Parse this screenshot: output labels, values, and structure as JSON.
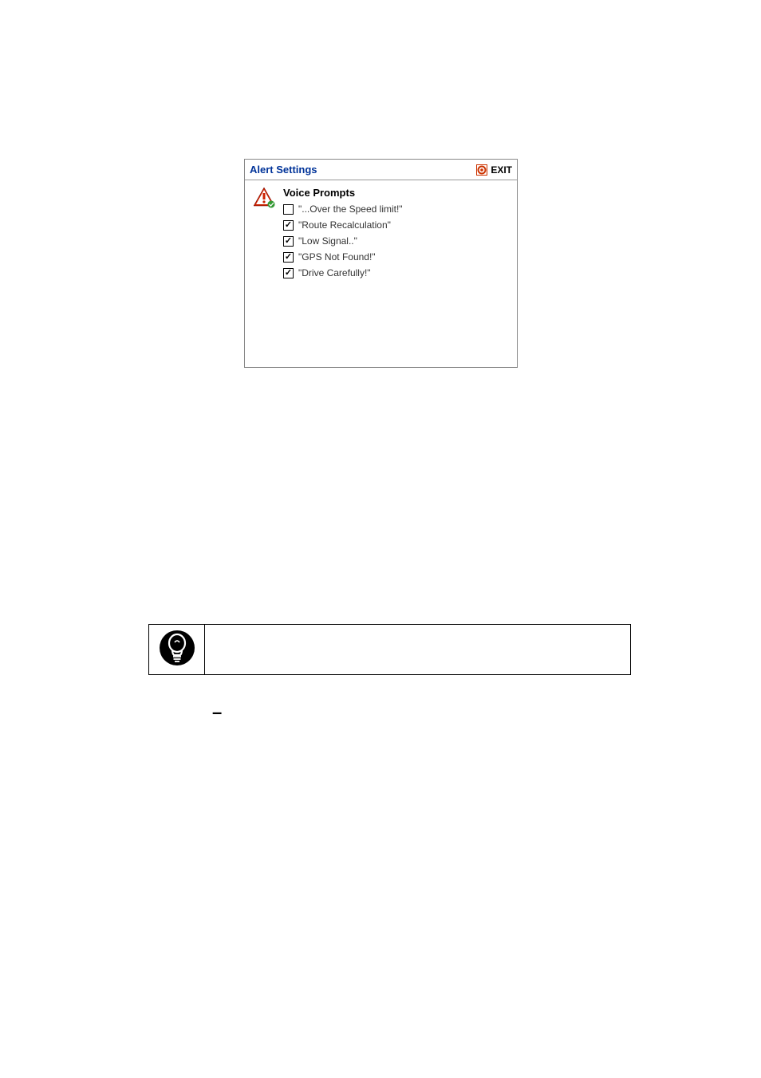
{
  "panel": {
    "title": "Alert Settings",
    "exit_label": "EXIT"
  },
  "voice_prompts": {
    "heading": "Voice Prompts",
    "items": [
      {
        "label": "\"...Over the Speed limit!\"",
        "checked": false
      },
      {
        "label": "\"Route Recalculation\"",
        "checked": true
      },
      {
        "label": "\"Low Signal..\"",
        "checked": true
      },
      {
        "label": "\"GPS Not Found!\"",
        "checked": true
      },
      {
        "label": "\"Drive Carefully!\"",
        "checked": true
      }
    ]
  },
  "dash": "–"
}
